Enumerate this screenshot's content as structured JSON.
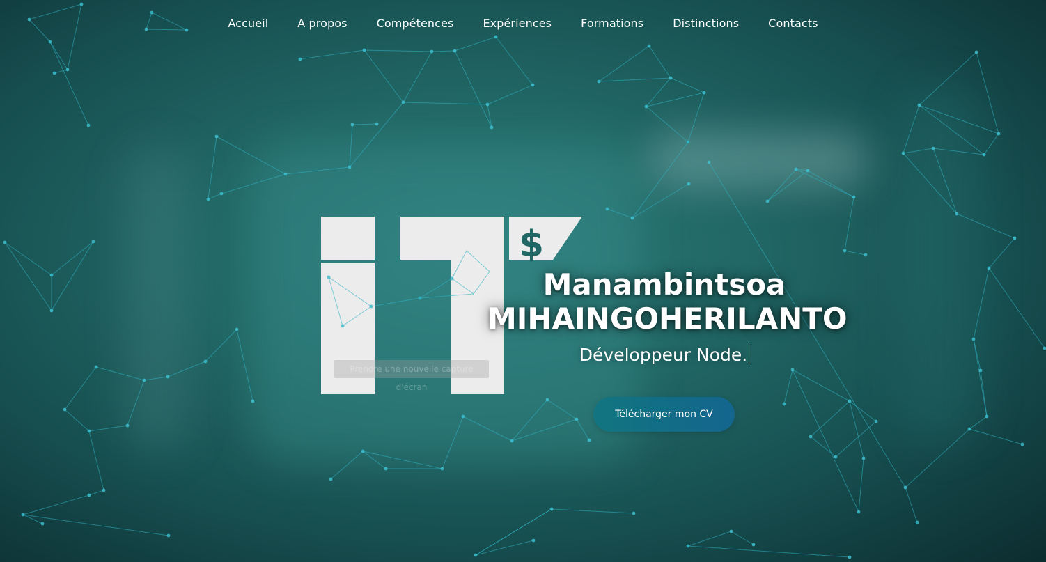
{
  "nav": {
    "items": [
      {
        "label": "Accueil"
      },
      {
        "label": "A propos"
      },
      {
        "label": "Compétences"
      },
      {
        "label": "Expériences"
      },
      {
        "label": "Formations"
      },
      {
        "label": "Distinctions"
      },
      {
        "label": "Contacts"
      }
    ]
  },
  "logo": {
    "text": "IT$"
  },
  "overlay": {
    "tooltip": "Prendre une nouvelle capture d'écran"
  },
  "hero": {
    "first_name": "Manambintsoa",
    "last_name": "MIHAINGOHERILANTO",
    "subtitle": "Développeur Node.",
    "cta_label": "Télécharger mon CV"
  },
  "colors": {
    "background": "#216765",
    "button": "#12757f",
    "network_lines": "#2fb4c4",
    "logo": "#ececec"
  }
}
